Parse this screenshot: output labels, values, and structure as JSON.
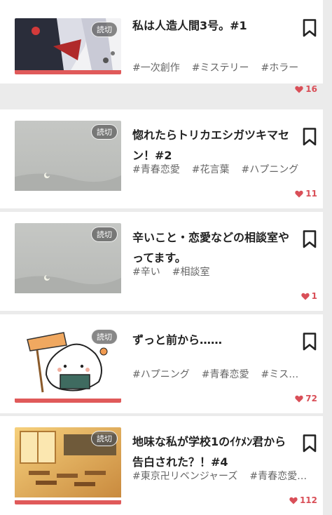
{
  "badge_label": "読切",
  "stories": [
    {
      "title": "私は人造人間3号。#1",
      "tags": [
        "#一次創作",
        "#ミステリー",
        "#ホラー"
      ],
      "likes": "16"
    },
    {
      "title": "惚れたらトリカエシガツキマセン！#2",
      "tags": [
        "#青春恋愛",
        "#花言葉",
        "#ハプニング"
      ],
      "likes": "11"
    },
    {
      "title": "辛いこと・恋愛などの相談室やってます。",
      "tags": [
        "#辛い",
        "#相談室"
      ],
      "likes": "1"
    },
    {
      "title": "ずっと前から……",
      "tags": [
        "#ハプニング",
        "#青春恋愛",
        "#ミス…"
      ],
      "likes": "72"
    },
    {
      "title": "地味な私が学校1のｲｹﾒﾝ君から告白された？！#4",
      "tags": [
        "#東京卍リベンジャーズ",
        "#青春恋愛…"
      ],
      "likes": "112"
    }
  ],
  "colors": {
    "accent": "#e05a5a",
    "heart": "#d94f58"
  },
  "icons": [
    "bookmark-icon",
    "heart-icon"
  ]
}
